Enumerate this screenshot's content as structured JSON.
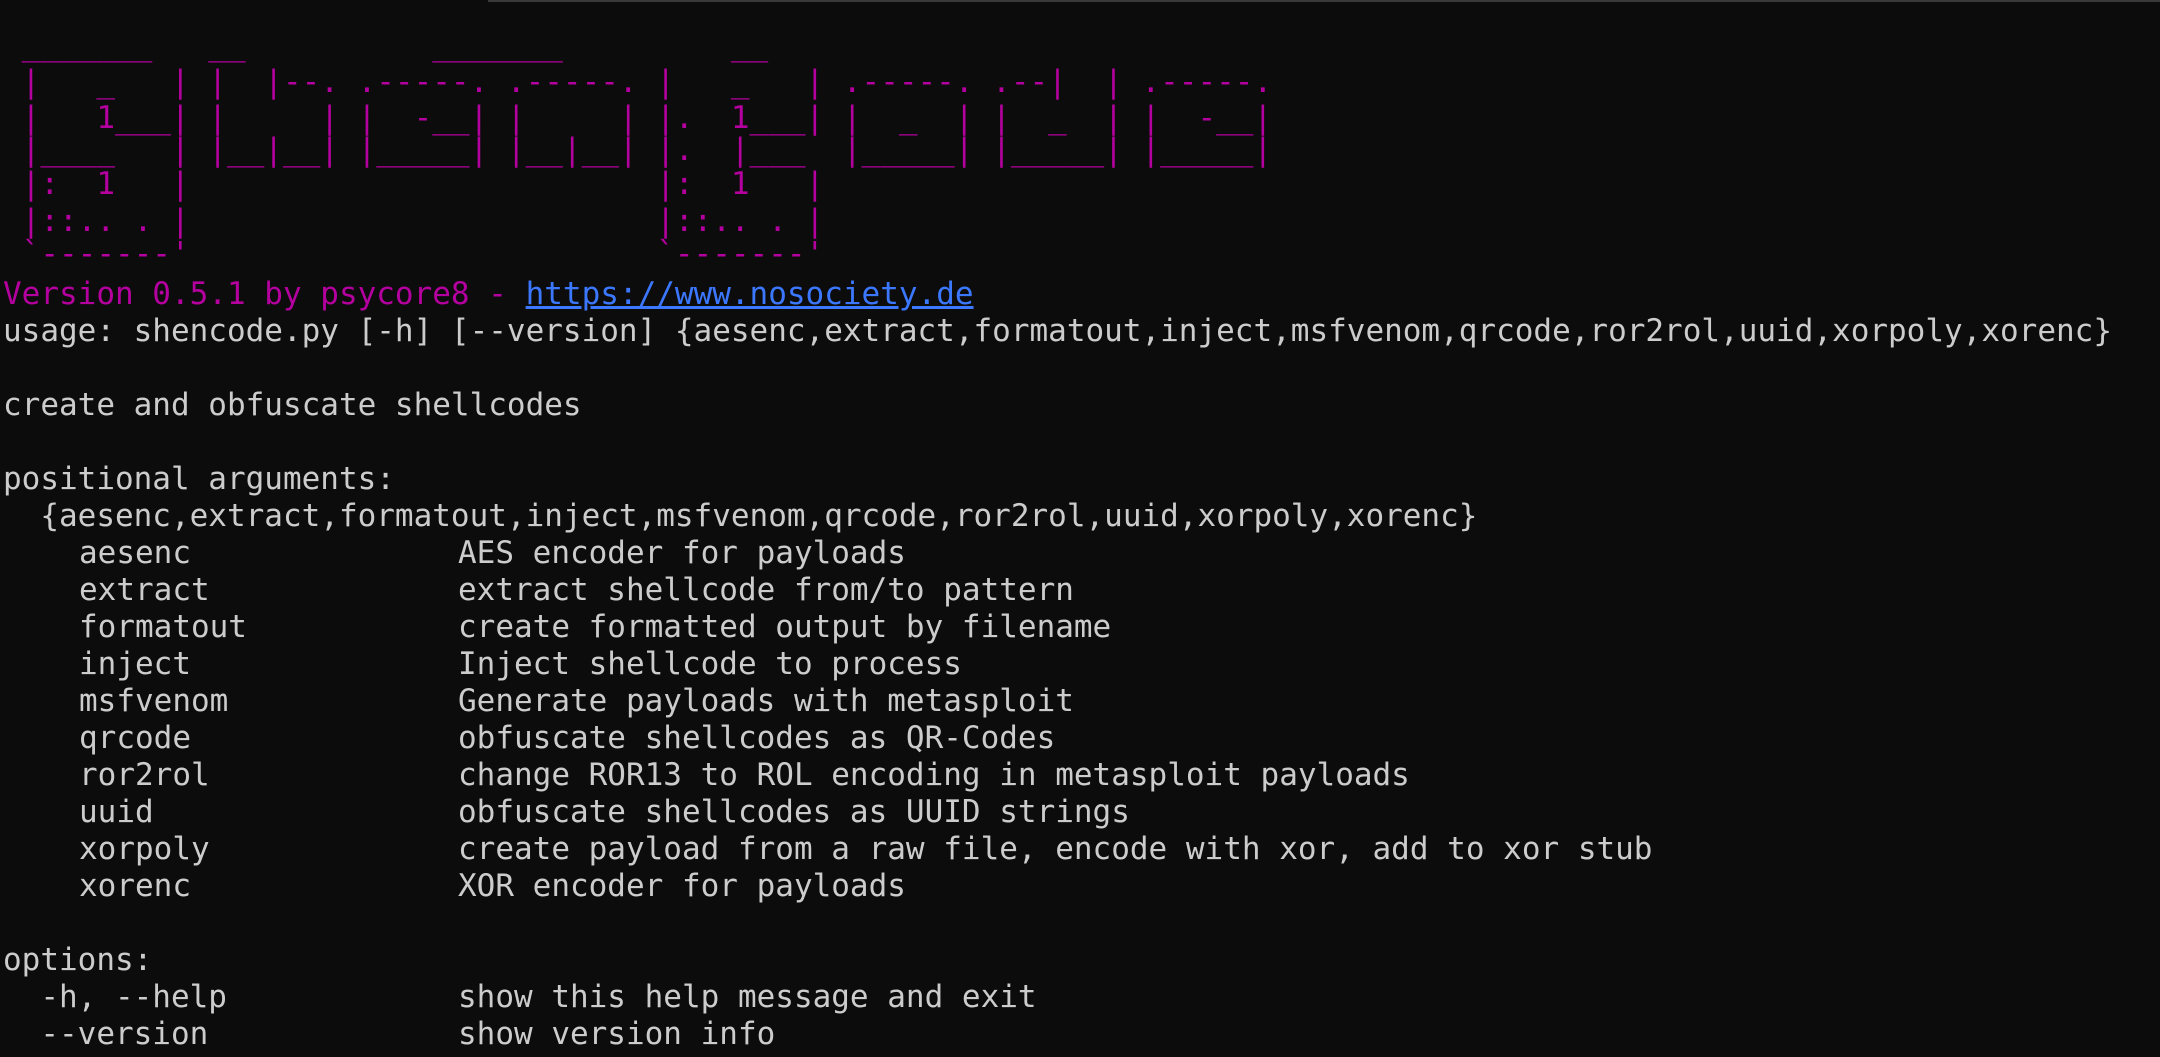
{
  "banner": {
    "art": [
      " _______   __          _______         __            ",
      " |   _   | |  |--. .-----. .-----. |   _   | .-----. .--|  | .-----.",
      " |   1___| |     | |  -__| |     | |.  1___| |  _  | |  _  | |  -__|",
      " |____   | |__|__| |_____| |__|__| |.  |___  |_____| |_____| |_____|",
      " |:  1   |                         |:  1   |",
      " |::.. . |                         |::.. . |",
      " `-------'                         `-------'"
    ],
    "version_text": "Version 0.5.1 by psycore8 - ",
    "version_link": "https://www.nosociety.de"
  },
  "usage_line": "usage: shencode.py [-h] [--version] {aesenc,extract,formatout,inject,msfvenom,qrcode,ror2rol,uuid,xorpoly,xorenc}",
  "description": "create and obfuscate shellcodes",
  "positional": {
    "header": "positional arguments:",
    "choices": "  {aesenc,extract,formatout,inject,msfvenom,qrcode,ror2rol,uuid,xorpoly,xorenc}",
    "commands": [
      {
        "name": "aesenc",
        "help": "AES encoder for payloads"
      },
      {
        "name": "extract",
        "help": "extract shellcode from/to pattern"
      },
      {
        "name": "formatout",
        "help": "create formatted output by filename"
      },
      {
        "name": "inject",
        "help": "Inject shellcode to process"
      },
      {
        "name": "msfvenom",
        "help": "Generate payloads with metasploit"
      },
      {
        "name": "qrcode",
        "help": "obfuscate shellcodes as QR-Codes"
      },
      {
        "name": "ror2rol",
        "help": "change ROR13 to ROL encoding in metasploit payloads"
      },
      {
        "name": "uuid",
        "help": "obfuscate shellcodes as UUID strings"
      },
      {
        "name": "xorpoly",
        "help": "create payload from a raw file, encode with xor, add to xor stub"
      },
      {
        "name": "xorenc",
        "help": "XOR encoder for payloads"
      }
    ]
  },
  "options": {
    "header": "options:",
    "items": [
      {
        "flag": "  -h, --help",
        "help": "show this help message and exit"
      },
      {
        "flag": "  --version",
        "help": "show version info"
      }
    ]
  },
  "colors": {
    "background": "#0c0c0c",
    "text": "#cccccc",
    "banner": "#b4009e",
    "link": "#3b78ff"
  }
}
